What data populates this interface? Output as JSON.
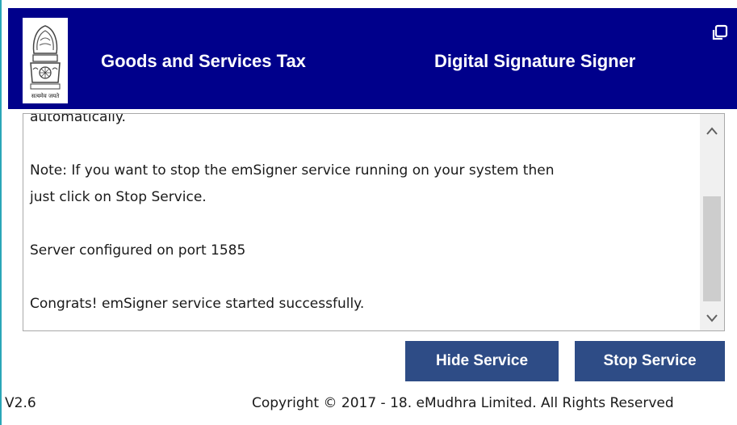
{
  "header": {
    "title": "Goods and Services Tax",
    "subtitle": "Digital Signature Signer",
    "emblem_icon": "state-emblem-icon",
    "emblem_caption": "सत्यमेव जयते",
    "restore_icon": "restore-window-icon"
  },
  "log": {
    "lines": [
      "automatically.",
      "",
      "Note: If you want to stop the emSigner service running on your system then",
      "just click on Stop Service.",
      "",
      "Server configured on port 1585",
      "",
      "Congrats! emSigner service started successfully."
    ]
  },
  "buttons": {
    "hide": "Hide Service",
    "stop": "Stop Service"
  },
  "footer": {
    "version": "V2.6",
    "copyright": "Copyright © 2017 - 18. eMudhra Limited. All Rights Reserved"
  },
  "colors": {
    "header_bg": "#00008b",
    "button_bg": "#2e4c86",
    "window_edge": "#2aa6b8"
  }
}
